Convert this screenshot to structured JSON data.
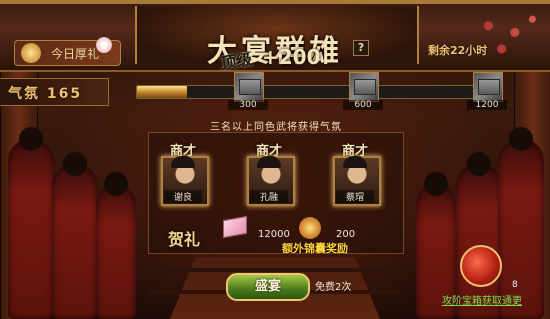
{
  "header": {
    "title": "大宴群雄",
    "badge_stamp": "顶级",
    "badge_score": "+200",
    "help": "?",
    "gift_tab": "今日厚礼",
    "remaining": "剩余22小时"
  },
  "progress": {
    "label": "气氛 165",
    "current": 165,
    "max": 1200,
    "milestones": [
      "300",
      "600",
      "1200"
    ]
  },
  "hint": "三名以上同色武将获得气氛",
  "generals": [
    {
      "tag": "商才",
      "name": "谢良"
    },
    {
      "tag": "商才",
      "name": "孔融"
    },
    {
      "tag": "商才",
      "name": "蔡瑁"
    }
  ],
  "rewards": {
    "title": "贺礼",
    "value1": "12000",
    "value2": "200",
    "extra_label": "额外锦囊奖励"
  },
  "actions": {
    "feast_button": "盛宴",
    "free_text": "免费2次",
    "round_count": "8",
    "treasure_link": "攻阶宝箱获取通更"
  }
}
